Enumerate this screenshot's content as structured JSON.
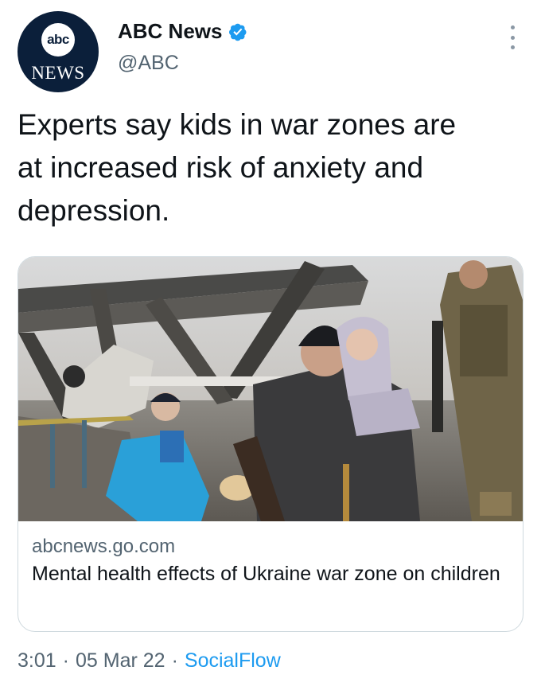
{
  "account": {
    "display_name": "ABC News",
    "handle": "@ABC",
    "verified": true,
    "avatar": {
      "logo_text": "abc",
      "wordmark": "NEWS"
    }
  },
  "tweet": {
    "text": "Experts say kids in war zones are\nat increased risk of anxiety and\ndepression."
  },
  "card": {
    "image_alt": "Man carrying a young child past a destroyed bridge with a girl and a soldier nearby",
    "domain": "abcnews.go.com",
    "title": "Mental health effects of Ukraine war zone on children"
  },
  "footer": {
    "time": "3:01",
    "separator": "·",
    "date": "05 Mar 22",
    "source": "SocialFlow"
  },
  "colors": {
    "verified": "#1d9bf0",
    "link": "#1d9bf0",
    "secondary_text": "#536471",
    "avatar_bg": "#0b1f3a"
  }
}
